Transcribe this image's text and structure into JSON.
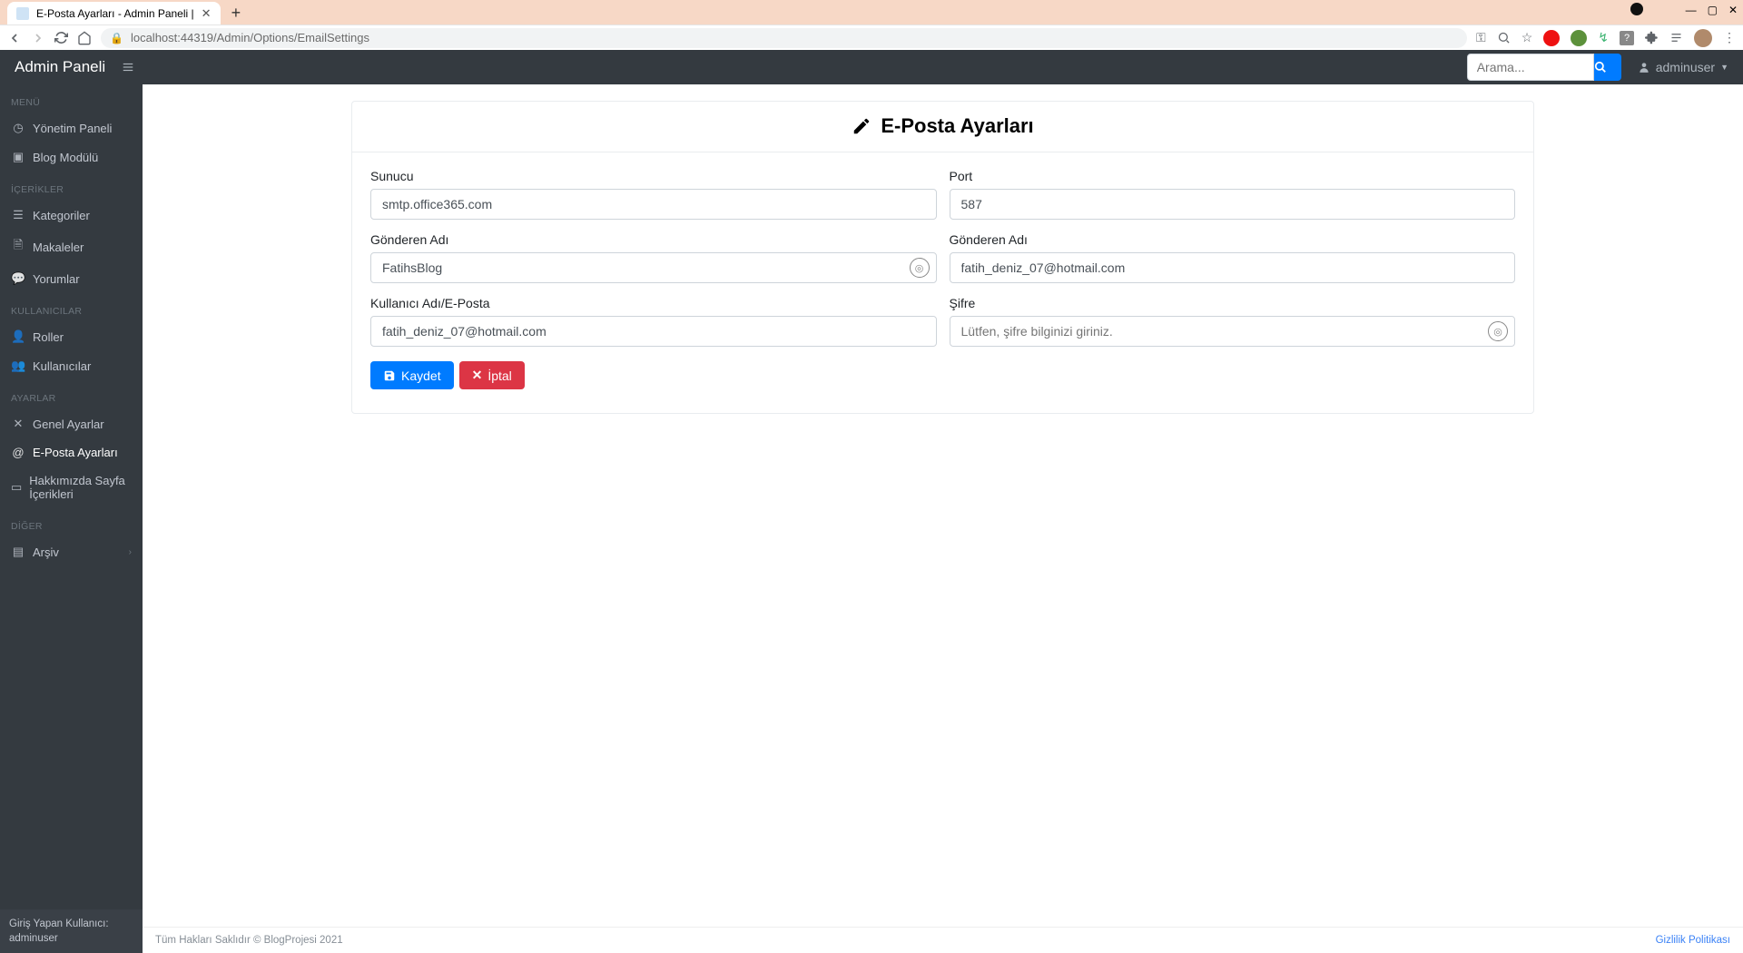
{
  "browser": {
    "tab_title": "E-Posta Ayarları - Admin Paneli |",
    "url": "localhost:44319/Admin/Options/EmailSettings"
  },
  "topbar": {
    "brand": "Admin Paneli",
    "search_placeholder": "Arama...",
    "username": "adminuser"
  },
  "sidebar": {
    "sections": {
      "menu": "MENÜ",
      "items1": [
        "Yönetim Paneli",
        "Blog Modülü"
      ],
      "contents": "İÇERİKLER",
      "items2": [
        "Kategoriler",
        "Makaleler",
        "Yorumlar"
      ],
      "users": "KULLANICILAR",
      "items3": [
        "Roller",
        "Kullanıcılar"
      ],
      "settings": "AYARLAR",
      "items4": [
        "Genel Ayarlar",
        "E-Posta Ayarları",
        "Hakkımızda Sayfa İçerikleri"
      ],
      "other": "DİĞER",
      "items5": [
        "Arşiv"
      ]
    },
    "footer_label": "Giriş Yapan Kullanıcı:",
    "footer_user": "adminuser"
  },
  "page": {
    "title": "E-Posta Ayarları",
    "labels": {
      "server": "Sunucu",
      "port": "Port",
      "sender_name": "Gönderen Adı",
      "sender_addr": "Gönderen Adı",
      "user_email": "Kullanıcı Adı/E-Posta",
      "password": "Şifre"
    },
    "values": {
      "server": "smtp.office365.com",
      "port": "587",
      "sender_name": "FatihsBlog",
      "sender_addr": "fatih_deniz_07@hotmail.com",
      "user_email": "fatih_deniz_07@hotmail.com",
      "password_placeholder": "Lütfen, şifre bilginizi giriniz."
    },
    "buttons": {
      "save": "Kaydet",
      "cancel": "İptal"
    }
  },
  "footer": {
    "copyright": "Tüm Hakları Saklıdır © BlogProjesi 2021",
    "privacy": "Gizlilik Politikası"
  }
}
